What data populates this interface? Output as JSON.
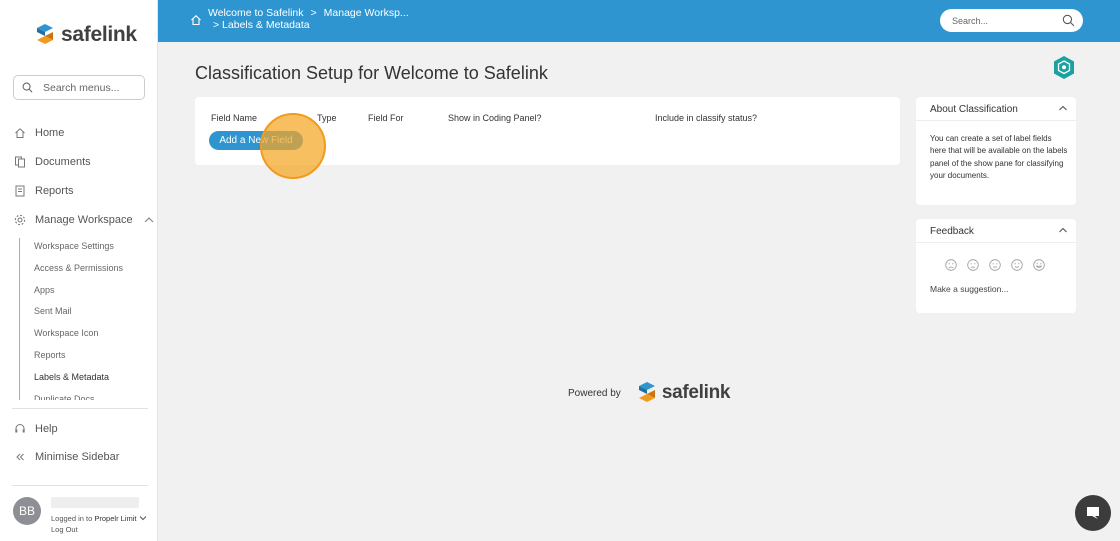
{
  "brand": {
    "name": "safelink",
    "colors": {
      "blue": "#2f95d0",
      "orange": "#f29a1d",
      "teal": "#1aa1a0"
    }
  },
  "sidebar": {
    "search_placeholder": "Search menus...",
    "items": [
      {
        "label": "Home",
        "icon": "home-icon"
      },
      {
        "label": "Documents",
        "icon": "documents-icon"
      },
      {
        "label": "Reports",
        "icon": "reports-icon"
      },
      {
        "label": "Manage Workspace",
        "icon": "gear-icon"
      }
    ],
    "sub_items": [
      "Workspace Settings",
      "Access & Permissions",
      "Apps",
      "Sent Mail",
      "Workspace Icon",
      "Reports",
      "Labels & Metadata",
      "Duplicate Docs"
    ],
    "active_sub": "Labels & Metadata",
    "help_label": "Help",
    "minimise_label": "Minimise Sidebar",
    "user": {
      "initials": "BB",
      "logged_in_text": "Logged in to",
      "org": "Propelr Limit",
      "logout": "Log Out"
    }
  },
  "topbar": {
    "breadcrumb": [
      "Welcome to Safelink",
      "Manage Worksp..."
    ],
    "breadcrumb_sep": ">",
    "breadcrumb_line2": "> Labels & Metadata",
    "search_placeholder": "Search..."
  },
  "main": {
    "title": "Classification Setup for Welcome to Safelink",
    "columns": [
      "Field Name",
      "Type",
      "Field For",
      "Show in Coding Panel?",
      "Include in classify status?"
    ],
    "add_button": "Add a New Field"
  },
  "about": {
    "title": "About Classification",
    "body": "You can create a set of label fields here that will be available on the labels panel of the show pane for classifying your documents."
  },
  "feedback": {
    "title": "Feedback",
    "faces": [
      "very-unhappy",
      "unhappy",
      "neutral",
      "happy",
      "very-happy"
    ],
    "suggestion": "Make a suggestion..."
  },
  "footer": {
    "powered_by": "Powered by",
    "brand": "safelink"
  }
}
